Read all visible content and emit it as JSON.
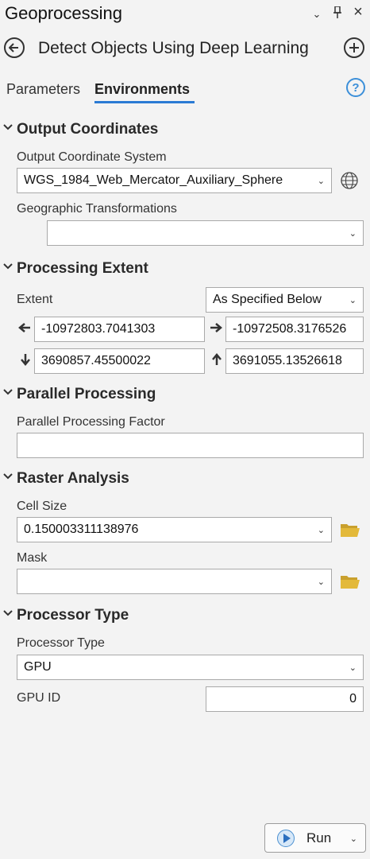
{
  "pane": {
    "title": "Geoprocessing",
    "controls": {
      "menu": "⌄",
      "pin": "📌",
      "close": "×"
    }
  },
  "tool": {
    "title": "Detect Objects Using Deep Learning",
    "back_icon": "arrow-left-circle-icon",
    "add_icon": "plus-circle-icon"
  },
  "tabs": [
    {
      "label": "Parameters",
      "active": false
    },
    {
      "label": "Environments",
      "active": true
    }
  ],
  "help": {
    "label": "?"
  },
  "sections": {
    "output_coordinates": {
      "title": "Output Coordinates",
      "ocs_label": "Output Coordinate System",
      "ocs_value": "WGS_1984_Web_Mercator_Auxiliary_Sphere",
      "geo_label": "Geographic Transformations",
      "geo_value": ""
    },
    "processing_extent": {
      "title": "Processing Extent",
      "extent_label": "Extent",
      "extent_value": "As Specified Below",
      "left": "-10972803.7041303",
      "right": "-10972508.3176526",
      "bottom": "3690857.45500022",
      "top": "3691055.13526618"
    },
    "parallel_processing": {
      "title": "Parallel Processing",
      "factor_label": "Parallel Processing Factor",
      "factor_value": ""
    },
    "raster_analysis": {
      "title": "Raster Analysis",
      "cell_label": "Cell Size",
      "cell_value": "0.150003311138976",
      "mask_label": "Mask",
      "mask_value": ""
    },
    "processor_type": {
      "title": "Processor Type",
      "type_label": "Processor Type",
      "type_value": "GPU",
      "gpu_label": "GPU ID",
      "gpu_value": "0"
    }
  },
  "run": {
    "label": "Run"
  },
  "colors": {
    "accent": "#2b7bd4",
    "folder": "#e3b93a",
    "background": "#f3f3f3"
  }
}
